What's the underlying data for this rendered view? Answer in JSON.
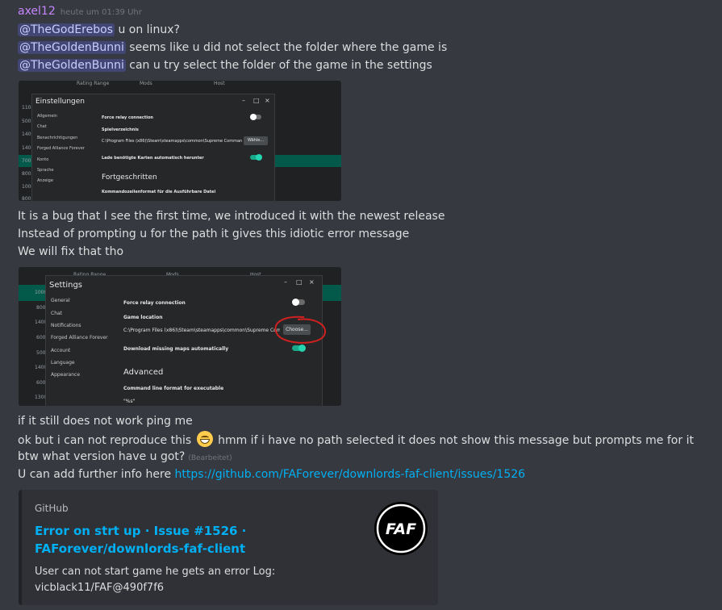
{
  "message": {
    "username": "axel12",
    "timestamp": "heute um 01:39 Uhr",
    "lines": [
      {
        "mention": "@TheGodErebos",
        "text": " u on linux?"
      },
      {
        "mention": "@TheGoldenBunni",
        "text": " seems like u did not select the folder where the game is"
      },
      {
        "mention": "@TheGoldenBunni",
        "text": " can u try select the folder of the game in the settings"
      }
    ],
    "paragraph": [
      "It is a bug that I see the first time, we introduced it with the newest release",
      "Instead of prompting u for the path it gives this idiotic error message",
      "We will fix that tho"
    ],
    "after": {
      "line1": "if it still does not work ping me",
      "line2_before": "ok but i can not reproduce this",
      "line2_after": "hmm if i have no path selected it does not show this message but prompts me for it",
      "line3": "btw what version have u got?",
      "line3_edited": "(Bearbeitet)",
      "line4_text": "U can add further info here ",
      "line4_link": "https://github.com/FAForever/downlords-faf-client/issues/1526"
    }
  },
  "screenshot1": {
    "window_title": "Einstellungen",
    "header_cols": [
      "Rating Range",
      "Mods",
      "Host"
    ],
    "side_numbers": [
      "1100",
      "500",
      "1400",
      "1400",
      "700",
      "800",
      "1000",
      "800"
    ],
    "nav": [
      "Allgemein",
      "Chat",
      "Benachrichtigungen",
      "Forged Alliance Forever",
      "Konto",
      "Sprache",
      "Anzeige"
    ],
    "relay_label": "Force relay connection",
    "folder_label": "Spielverzeichnis",
    "path": "C:\\Program Files (x86)\\Steam\\steamapps\\common\\Supreme Commander",
    "button": "Wähle...",
    "download_label": "Lade benötigte Karten automatisch herunter",
    "section": "Fortgeschritten",
    "cmd_label": "Kommandozeilenformat für die Ausführbare Datei"
  },
  "screenshot2": {
    "window_title": "Settings",
    "header_cols": [
      "Rating Range",
      "Mods",
      "Host"
    ],
    "side_numbers": [
      "1000",
      "800",
      "1400",
      "600",
      "500",
      "1400",
      "600",
      "1300"
    ],
    "nav": [
      "General",
      "Chat",
      "Notifications",
      "Forged Alliance Forever",
      "Account",
      "Language",
      "Appearance"
    ],
    "relay_label": "Force relay connection",
    "folder_label": "Game location",
    "path": "C:\\Program Files (x86)\\Steam\\steamapps\\common\\Supreme Commander",
    "button": "Choose...",
    "download_label": "Download missing maps automatically",
    "section": "Advanced",
    "cmd_label": "Command line format for executable",
    "cmd_value": "\"%s\""
  },
  "embed": {
    "provider": "GitHub",
    "title": "Error on strt up · Issue #1526 · FAForever/downlords-faf-client",
    "description_line1": "User can not start game he gets an error Log:",
    "description_line2": "vicblack11/FAF@490f7f6",
    "thumb_text": "FAF"
  },
  "colors": {
    "background": "#36393f",
    "username": "#c585ff",
    "mention_bg": "#414675",
    "link": "#00b0f4",
    "teal_toggle": "#1aa88a",
    "annotation_red": "#d02020"
  }
}
